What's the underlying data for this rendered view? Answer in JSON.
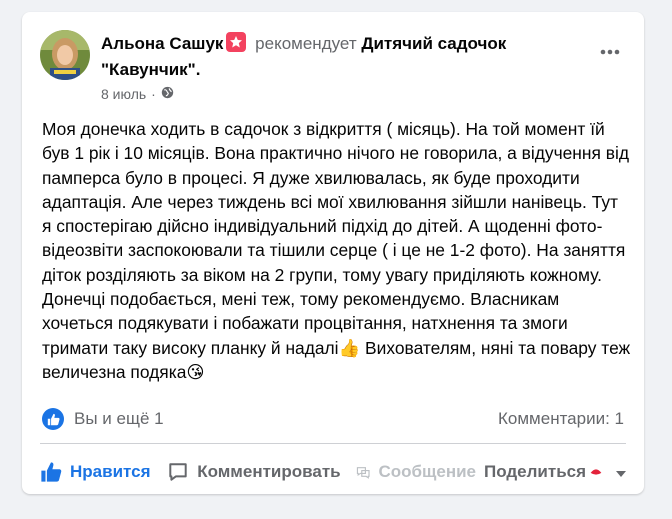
{
  "post": {
    "author": "Альона Сашук",
    "recommends_verb": "рекомендует",
    "page_name": "Дитячий садочок \"Кавунчик\".",
    "date": "8 июль",
    "dot": "·",
    "icons": {
      "recommend": "star-badge-icon",
      "audience": "globe-icon",
      "more": "more-horizontal-icon"
    },
    "body": "Моя донечка ходить в садочок з відкриття ( місяць). На той момент їй був 1 рік і 10 місяців. Вона практично нічого не говорила, а відучення від памперса було в процесі. Я дуже хвилювалась, як буде проходити адаптація. Але через тиждень всі мої хвилювання зійшли нанівець. Тут я спостерігаю дійсно індивідуальний підхід до дітей. А щоденні фото- відеозвіти заспокоювали та тішили серце ( і це не 1-2 фото). На заняття діток розділяють за віком на 2 групи, тому увагу приділяють кожному. Донечці подобається, мені теж, тому рекомендуємо. Власникам хочеться подякувати і побажати процвітання, натхнення та змоги тримати таку високу планку й надалі👍 Вихователям, няні та повару теж величезна подяка😘"
  },
  "reactions": {
    "summary": "Вы и ещё 1",
    "comments": "Комментарии: 1"
  },
  "actions": {
    "like": "Нравится",
    "comment": "Комментировать",
    "message": "Сообщение",
    "share": "Поделиться"
  },
  "colors": {
    "accent": "#1b74e4",
    "recommend_badge": "#f3425f",
    "secondary_text": "#65676b"
  }
}
